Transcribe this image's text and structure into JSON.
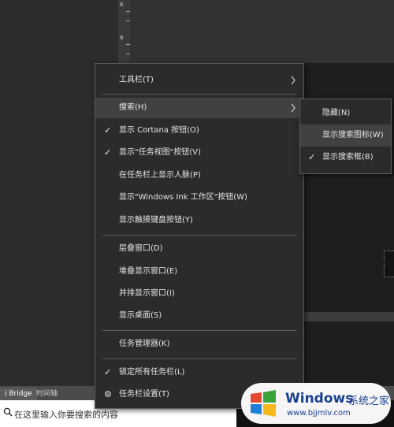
{
  "ruler": {
    "marks": [
      "6",
      "8"
    ]
  },
  "panel_tabs": [
    "i Bridge",
    "时间轴"
  ],
  "search": {
    "placeholder": "在这里输入你要搜索的内容"
  },
  "context_menu": {
    "items": [
      {
        "label": "工具栏(T)",
        "checked": false,
        "submenu": true
      },
      {
        "label": "搜索(H)",
        "checked": false,
        "submenu": true,
        "highlighted": true
      },
      {
        "label": "显示 Cortana 按钮(O)",
        "checked": true
      },
      {
        "label": "显示\"任务视图\"按钮(V)",
        "checked": true
      },
      {
        "label": "在任务栏上显示人脉(P)",
        "checked": false
      },
      {
        "label": "显示\"Windows Ink 工作区\"按钮(W)",
        "checked": false
      },
      {
        "label": "显示触摸键盘按钮(Y)",
        "checked": false
      },
      {
        "label": "层叠窗口(D)",
        "checked": false
      },
      {
        "label": "堆叠显示窗口(E)",
        "checked": false
      },
      {
        "label": "并排显示窗口(I)",
        "checked": false
      },
      {
        "label": "显示桌面(S)",
        "checked": false
      },
      {
        "label": "任务管理器(K)",
        "checked": false
      },
      {
        "label": "锁定所有任务栏(L)",
        "checked": true
      },
      {
        "label": "任务栏设置(T)",
        "checked": false,
        "icon": "gear-icon"
      }
    ]
  },
  "search_submenu": {
    "items": [
      {
        "label": "隐藏(N)",
        "checked": false
      },
      {
        "label": "显示搜索图标(W)",
        "checked": false,
        "highlighted": true
      },
      {
        "label": "显示搜索框(B)",
        "checked": true
      }
    ]
  },
  "watermark": {
    "brand": "Windows",
    "brand_cn": "系统之家",
    "url": "www.bjjmlv.com"
  },
  "colors": {
    "menu_bg": "#2b2b2b",
    "highlight": "#414141",
    "watermark_text": "#1a3f8f"
  }
}
